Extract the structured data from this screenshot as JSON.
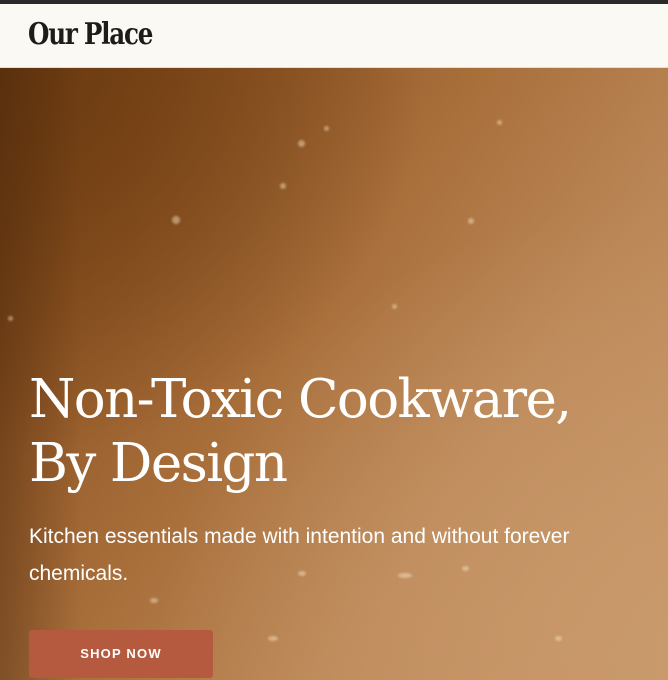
{
  "header": {
    "logo_text": "Our Place"
  },
  "hero": {
    "title_line1": "Non-Toxic Cookware,",
    "title_line2": "By Design",
    "subtitle": "Kitchen essentials made with intention and without forever chemicals.",
    "cta_label": "SHOP NOW"
  },
  "colors": {
    "top_bar": "#2a2a2a",
    "header_bg": "#fbf9f4",
    "hero_dark": "#7a4416",
    "hero_light": "#c69566",
    "cta_bg": "#b55a3e",
    "text_light": "#ffffff"
  }
}
